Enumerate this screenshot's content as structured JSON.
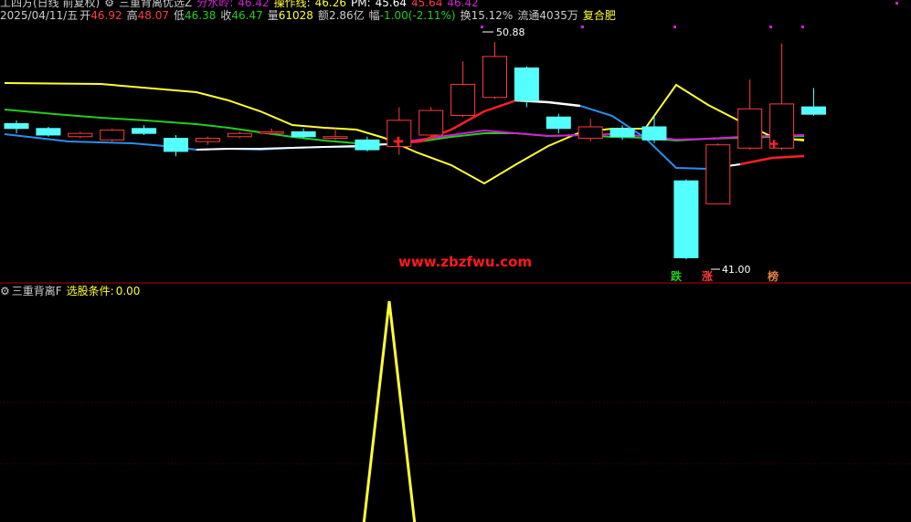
{
  "header": {
    "title": "工四方(日线 前复权)",
    "indicator_name": "三重背离优选Z",
    "fen_shui_ling_label": "分水岭:",
    "fen_shui_ling_value": "46.42",
    "cao_zuo_xian_label": "操作线:",
    "cao_zuo_xian_value": "46.26",
    "pm_label": "PM:",
    "pm_value": "45.64",
    "extra_value_1": "45.64",
    "extra_value_2": "46.42"
  },
  "quote": {
    "date": "2025/04/11/五",
    "open_label": "开",
    "open": "46.92",
    "high_label": "高",
    "high": "48.07",
    "low_label": "低",
    "low": "46.38",
    "close_label": "收",
    "close": "46.47",
    "volume_label": "量",
    "volume": "61028",
    "amount_label": "额",
    "amount": "2.86亿",
    "change_label": "幅",
    "change": "-1.00(-2.11%)",
    "turnover_label": "换",
    "turnover": "15.12%",
    "float_label": "流通",
    "float": "4035万",
    "region": "复合肥"
  },
  "main_chart": {
    "high_marker": "50.88",
    "low_marker": "41.00",
    "watermark": "www.zbzfwu.com",
    "signal_die": "跌",
    "signal_zhang": "涨",
    "signal_bang": "榜"
  },
  "sub_chart": {
    "name": "三重背离F",
    "condition_label": "选股条件:",
    "condition_value": "0.00"
  },
  "colors": {
    "background": "#000000",
    "up_candle": "#ff3c3c",
    "down_candle": "#54ffff",
    "yellow": "#ffff33",
    "green": "#22cc22",
    "blue": "#2a8fef",
    "magenta": "#d21fd2",
    "white": "#ffffff",
    "red": "#ff2020",
    "divider": "#b00000"
  },
  "chart_data": {
    "type": "candlestick",
    "candles": [
      {
        "o": 45.9,
        "c": 45.6,
        "h": 46.1,
        "l": 45.3
      },
      {
        "o": 45.6,
        "c": 45.2,
        "h": 45.7,
        "l": 45.1
      },
      {
        "o": 45.1,
        "c": 45.3,
        "h": 45.4,
        "l": 45.0
      },
      {
        "o": 44.9,
        "c": 45.5,
        "h": 45.6,
        "l": 44.8
      },
      {
        "o": 45.6,
        "c": 45.3,
        "h": 45.8,
        "l": 45.2
      },
      {
        "o": 45.0,
        "c": 44.2,
        "h": 45.2,
        "l": 43.9
      },
      {
        "o": 44.8,
        "c": 45.0,
        "h": 45.1,
        "l": 44.6
      },
      {
        "o": 45.1,
        "c": 45.3,
        "h": 45.4,
        "l": 45.0
      },
      {
        "o": 45.3,
        "c": 45.4,
        "h": 45.6,
        "l": 45.2
      },
      {
        "o": 45.4,
        "c": 45.1,
        "h": 45.6,
        "l": 45.0
      },
      {
        "o": 45.0,
        "c": 45.1,
        "h": 45.6,
        "l": 44.9
      },
      {
        "o": 44.9,
        "c": 44.3,
        "h": 45.1,
        "l": 44.2
      },
      {
        "o": 44.5,
        "c": 46.1,
        "h": 46.9,
        "l": 44.0
      },
      {
        "o": 45.2,
        "c": 46.7,
        "h": 46.9,
        "l": 45.1
      },
      {
        "o": 46.4,
        "c": 48.3,
        "h": 49.7,
        "l": 46.3
      },
      {
        "o": 47.5,
        "c": 50.0,
        "h": 50.88,
        "l": 47.4
      },
      {
        "o": 49.3,
        "c": 47.3,
        "h": 49.4,
        "l": 46.9
      },
      {
        "o": 46.3,
        "c": 45.6,
        "h": 46.5,
        "l": 45.3
      },
      {
        "o": 45.0,
        "c": 45.7,
        "h": 46.2,
        "l": 44.8
      },
      {
        "o": 45.6,
        "c": 45.1,
        "h": 45.8,
        "l": 44.9
      },
      {
        "o": 45.7,
        "c": 44.9,
        "h": 46.4,
        "l": 44.7
      },
      {
        "o": 42.4,
        "c": 37.7,
        "h": 42.5,
        "l": 37.6
      },
      {
        "o": 41.0,
        "c": 44.6,
        "h": 44.7,
        "l": 41.0
      },
      {
        "o": 44.4,
        "c": 46.8,
        "h": 48.6,
        "l": 44.3
      },
      {
        "o": 44.4,
        "c": 47.1,
        "h": 50.8,
        "l": 44.3
      },
      {
        "o": 46.92,
        "c": 46.47,
        "h": 48.07,
        "l": 46.38
      }
    ],
    "ylim": [
      37.0,
      51.5
    ],
    "sub_signal": {
      "peak_index": 12,
      "value": 1,
      "ylim": [
        0,
        1
      ]
    }
  }
}
